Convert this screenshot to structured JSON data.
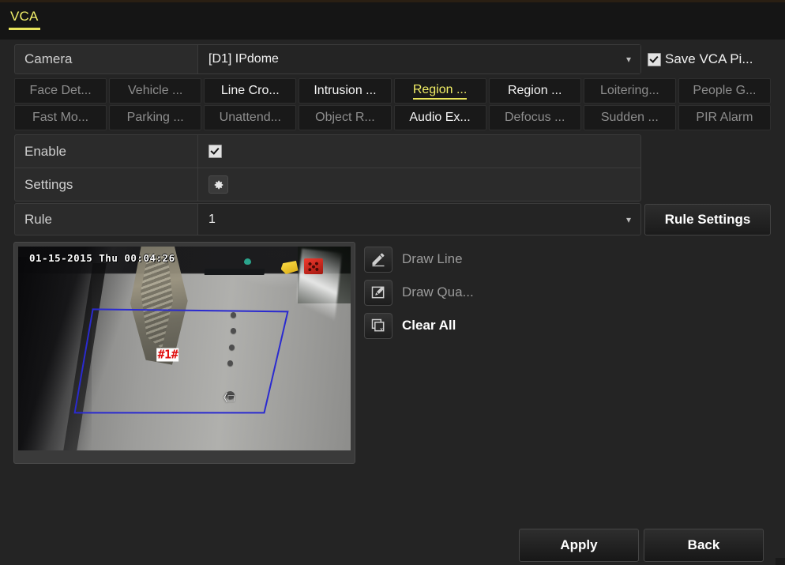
{
  "window": {
    "page_tab": "VCA"
  },
  "camera": {
    "label": "Camera",
    "value": "[D1] IPdome",
    "caret": "chevron-down-icon",
    "save_vca_label": "Save VCA Pi...",
    "save_vca_checked": true
  },
  "tabs": {
    "row1": [
      {
        "label": "Face Det...",
        "state": "dim"
      },
      {
        "label": "Vehicle ...",
        "state": "dim"
      },
      {
        "label": "Line Cro...",
        "state": "bright"
      },
      {
        "label": "Intrusion ...",
        "state": "bright"
      },
      {
        "label": "Region ...",
        "state": "active"
      },
      {
        "label": "Region ...",
        "state": "bright"
      },
      {
        "label": "Loitering...",
        "state": "dim"
      },
      {
        "label": "People G...",
        "state": "dim"
      }
    ],
    "row2": [
      {
        "label": "Fast Mo...",
        "state": "dim"
      },
      {
        "label": "Parking ...",
        "state": "dim"
      },
      {
        "label": "Unattend...",
        "state": "dim"
      },
      {
        "label": "Object R...",
        "state": "dim"
      },
      {
        "label": "Audio Ex...",
        "state": "bright"
      },
      {
        "label": "Defocus ...",
        "state": "dim"
      },
      {
        "label": "Sudden ...",
        "state": "dim"
      },
      {
        "label": "PIR Alarm",
        "state": "dim"
      }
    ]
  },
  "form": {
    "enable_label": "Enable",
    "enable_checked": true,
    "settings_label": "Settings",
    "settings_icon": "gear-icon",
    "rule_label": "Rule",
    "rule_value": "1",
    "rule_settings_button": "Rule Settings"
  },
  "preview": {
    "osd_timestamp": "01-15-2015 Thu 00:04:26",
    "rule_tag": "#1#",
    "region_color": "#2a2ad0"
  },
  "tools": [
    {
      "label": "Draw Line",
      "icon": "pencil-icon",
      "enabled": false
    },
    {
      "label": "Draw Qua...",
      "icon": "draw-quad-icon",
      "enabled": false
    },
    {
      "label": "Clear All",
      "icon": "clear-all-icon",
      "enabled": true
    }
  ],
  "footer": {
    "apply_label": "Apply",
    "back_label": "Back"
  }
}
